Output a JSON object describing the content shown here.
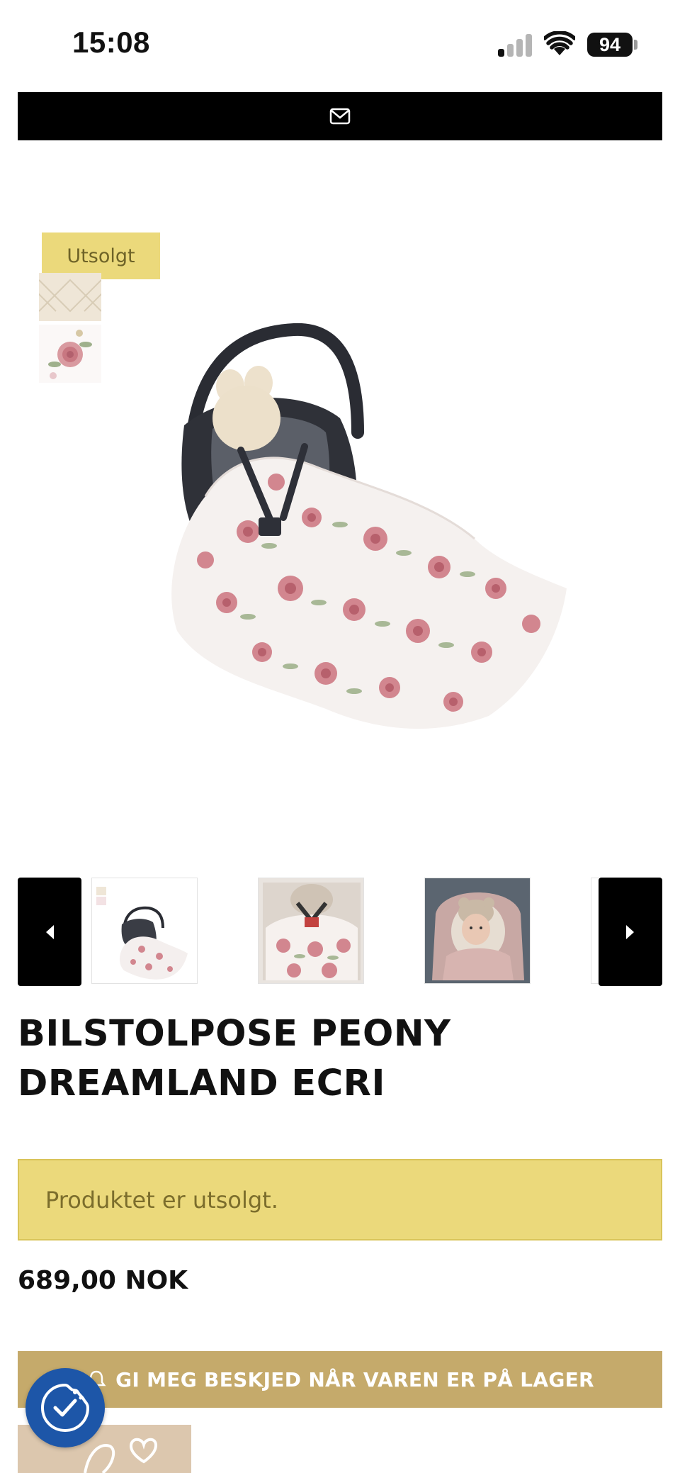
{
  "status_bar": {
    "time": "15:08",
    "battery": "94",
    "signal_bars_active": 1
  },
  "top_bar": {
    "icon": "mail-icon",
    "background": "#000000"
  },
  "product": {
    "badge": "Utsolgt",
    "title": "BILSTOLPOSE PEONY DREAMLAND ECRI",
    "sold_out_notice": "Produktet er utsolgt.",
    "price": "689,00 NOK",
    "notify_button": "GI MEG BESKJED NÅR VAREN ER PÅ LAGER"
  },
  "gallery": {
    "prev_icon": "caret-left-icon",
    "next_icon": "caret-right-icon",
    "thumbnails": [
      "car-seat-blanket",
      "baby-in-blanket",
      "baby-in-pink-wrap"
    ]
  },
  "colors": {
    "badge": "#ebd97b",
    "notify_button": "#c5aa6b",
    "cookie_button": "#1d56a8"
  }
}
